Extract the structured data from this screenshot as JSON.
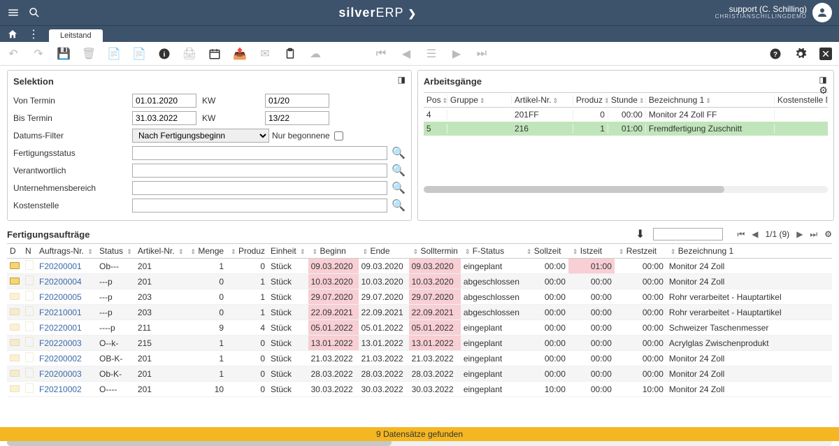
{
  "header": {
    "brand_1": "silver",
    "brand_2": "ERP",
    "user_line1": "support (C. Schilling)",
    "user_line2": "CHRISTIANSCHILLINGDEMO",
    "tab": "Leitstand"
  },
  "selektion": {
    "title": "Selektion",
    "von_termin_label": "Von Termin",
    "von_termin": "01.01.2020",
    "kw_label_1": "KW",
    "kw_von": "01/20",
    "bis_termin_label": "Bis Termin",
    "bis_termin": "31.03.2022",
    "kw_label_2": "KW",
    "kw_bis": "13/22",
    "datums_filter_label": "Datums-Filter",
    "datums_filter": "Nach Fertigungsbeginn",
    "nur_begonnene": "Nur begonnene",
    "fertigungsstatus_label": "Fertigungsstatus",
    "verantwortlich_label": "Verantwortlich",
    "unternehmensbereich_label": "Unternehmensbereich",
    "kostenstelle_label": "Kostenstelle"
  },
  "arbeitsgaenge": {
    "title": "Arbeitsgänge",
    "headers": {
      "pos": "Pos",
      "gruppe": "Gruppe",
      "artikel": "Artikel-Nr.",
      "produz": "Produz",
      "stunden": "Stunde",
      "bez": "Bezeichnung 1",
      "kost": "Kostenstelle N"
    },
    "rows": [
      {
        "pos": "4",
        "gruppe": "",
        "artikel": "201FF",
        "produz": "0",
        "stunden": "00:00",
        "bez": "Monitor 24 Zoll FF",
        "kost": ""
      },
      {
        "pos": "5",
        "gruppe": "",
        "artikel": "216",
        "produz": "1",
        "stunden": "01:00",
        "bez": "Fremdfertigung Zuschnitt",
        "kost": ""
      }
    ]
  },
  "orders": {
    "title": "Fertigungsaufträge",
    "pager_text": "1/1 (9)",
    "headers": {
      "d": "D",
      "n": "N",
      "auftrag": "Auftrags-Nr.",
      "status": "Status",
      "artikel": "Artikel-Nr.",
      "menge": "Menge",
      "produz": "Produz",
      "einheit": "Einheit",
      "beginn": "Beginn",
      "ende": "Ende",
      "solltermin": "Solltermin",
      "fstatus": "F-Status",
      "sollzeit": "Sollzeit",
      "istzeit": "Istzeit",
      "restzeit": "Restzeit",
      "bez": "Bezeichnung 1"
    },
    "rows": [
      {
        "d": true,
        "auftrag": "F20200001",
        "status": "Ob---",
        "artikel": "201",
        "menge": "1",
        "produz": "0",
        "einheit": "Stück",
        "beginn": "09.03.2020",
        "ende": "09.03.2020",
        "soll": "09.03.2020",
        "fstatus": "eingeplant",
        "sollzeit": "00:00",
        "istzeit": "01:00",
        "restzeit": "00:00",
        "bez": "Monitor 24 Zoll",
        "pink": true,
        "istpink": true
      },
      {
        "d": true,
        "auftrag": "F20200004",
        "status": "---p",
        "artikel": "201",
        "menge": "0",
        "produz": "1",
        "einheit": "Stück",
        "beginn": "10.03.2020",
        "ende": "10.03.2020",
        "soll": "10.03.2020",
        "fstatus": "abgeschlossen",
        "sollzeit": "00:00",
        "istzeit": "00:00",
        "restzeit": "00:00",
        "bez": "Monitor 24 Zoll",
        "pink": true
      },
      {
        "d": false,
        "auftrag": "F20200005",
        "status": "---p",
        "artikel": "203",
        "menge": "0",
        "produz": "1",
        "einheit": "Stück",
        "beginn": "29.07.2020",
        "ende": "29.07.2020",
        "soll": "29.07.2020",
        "fstatus": "abgeschlossen",
        "sollzeit": "00:00",
        "istzeit": "00:00",
        "restzeit": "00:00",
        "bez": "Rohr verarbeitet - Hauptartikel",
        "pink": true
      },
      {
        "d": false,
        "auftrag": "F20210001",
        "status": "---p",
        "artikel": "203",
        "menge": "0",
        "produz": "1",
        "einheit": "Stück",
        "beginn": "22.09.2021",
        "ende": "22.09.2021",
        "soll": "22.09.2021",
        "fstatus": "abgeschlossen",
        "sollzeit": "00:00",
        "istzeit": "00:00",
        "restzeit": "00:00",
        "bez": "Rohr verarbeitet - Hauptartikel",
        "pink": true
      },
      {
        "d": false,
        "auftrag": "F20220001",
        "status": "----p",
        "artikel": "211",
        "menge": "9",
        "produz": "4",
        "einheit": "Stück",
        "beginn": "05.01.2022",
        "ende": "05.01.2022",
        "soll": "05.01.2022",
        "fstatus": "eingeplant",
        "sollzeit": "00:00",
        "istzeit": "00:00",
        "restzeit": "00:00",
        "bez": "Schweizer Taschenmesser",
        "pink": true
      },
      {
        "d": false,
        "auftrag": "F20220003",
        "status": "O--k-",
        "artikel": "215",
        "menge": "1",
        "produz": "0",
        "einheit": "Stück",
        "beginn": "13.01.2022",
        "ende": "13.01.2022",
        "soll": "13.01.2022",
        "fstatus": "eingeplant",
        "sollzeit": "00:00",
        "istzeit": "00:00",
        "restzeit": "00:00",
        "bez": "Acrylglas Zwischenprodukt",
        "pink": true
      },
      {
        "d": false,
        "auftrag": "F20200002",
        "status": "OB-K-",
        "artikel": "201",
        "menge": "1",
        "produz": "0",
        "einheit": "Stück",
        "beginn": "21.03.2022",
        "ende": "21.03.2022",
        "soll": "21.03.2022",
        "fstatus": "eingeplant",
        "sollzeit": "00:00",
        "istzeit": "00:00",
        "restzeit": "00:00",
        "bez": "Monitor 24 Zoll"
      },
      {
        "d": false,
        "auftrag": "F20200003",
        "status": "Ob-K-",
        "artikel": "201",
        "menge": "1",
        "produz": "0",
        "einheit": "Stück",
        "beginn": "28.03.2022",
        "ende": "28.03.2022",
        "soll": "28.03.2022",
        "fstatus": "eingeplant",
        "sollzeit": "00:00",
        "istzeit": "00:00",
        "restzeit": "00:00",
        "bez": "Monitor 24 Zoll"
      },
      {
        "d": false,
        "auftrag": "F20210002",
        "status": "O----",
        "artikel": "201",
        "menge": "10",
        "produz": "0",
        "einheit": "Stück",
        "beginn": "30.03.2022",
        "ende": "30.03.2022",
        "soll": "30.03.2022",
        "fstatus": "eingeplant",
        "sollzeit": "10:00",
        "istzeit": "00:00",
        "restzeit": "10:00",
        "bez": "Monitor 24 Zoll"
      }
    ]
  },
  "statusbar": "9 Datensätze gefunden"
}
